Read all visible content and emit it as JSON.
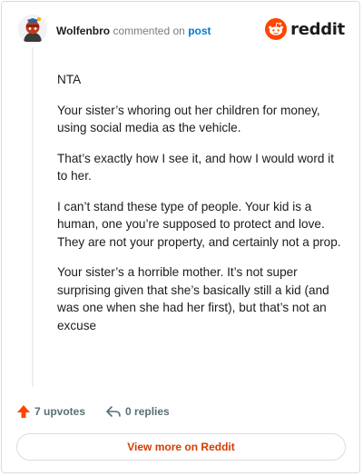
{
  "header": {
    "username": "Wolfenbro",
    "action_text": "commented on",
    "post_link": "post",
    "brand": "reddit"
  },
  "comment": {
    "paragraphs": [
      "NTA",
      "Your sister’s whoring out her children for money, using social media as the vehicle.",
      "That’s exactly how I see it, and how I would word it to her.",
      "I can’t stand these type of people. Your kid is a human, one you’re supposed to protect and love. They are not your property, and certainly not a prop.",
      "Your sister’s a horrible mother. It’s not super surprising given that she’s basically still a kid (and was one when she had her first), but that’s not an excuse"
    ]
  },
  "actions": {
    "upvotes": "7 upvotes",
    "replies": "0 replies"
  },
  "footer": {
    "view_more": "View more on Reddit"
  },
  "colors": {
    "accent": "#ff4500",
    "link": "#0079d3",
    "view_more": "#d93a00"
  },
  "icons": {
    "avatar": "avatar-icon",
    "reddit": "reddit-logo-icon",
    "upvote": "upvote-arrow-icon",
    "reply": "reply-arrow-icon"
  }
}
